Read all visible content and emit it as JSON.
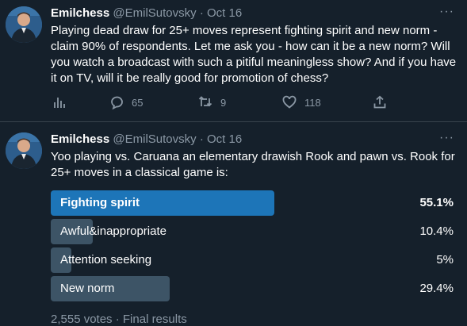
{
  "tweets": [
    {
      "name": "Emilchess",
      "handle": "@EmilSutovsky",
      "sep": "·",
      "date": "Oct 16",
      "more": "···",
      "text": "Playing dead draw for 25+ moves represent fighting spirit and new norm - claim 90% of respondents. Let me ask you - how can it be a new norm? Will you watch a broadcast with such a pitiful meaningless show? And if you have it on TV, will it be really good for promotion of chess?",
      "actions": {
        "analytics_icon": "bar-chart-icon",
        "reply_icon": "reply-icon",
        "reply_count": "65",
        "retweet_icon": "retweet-icon",
        "retweet_count": "9",
        "like_icon": "heart-icon",
        "like_count": "118",
        "share_icon": "share-icon"
      }
    },
    {
      "name": "Emilchess",
      "handle": "@EmilSutovsky",
      "sep": "·",
      "date": "Oct 16",
      "more": "···",
      "text": "Yoo playing vs. Caruana an elementary drawish Rook and pawn vs. Rook for 25+ moves in a classical game is:",
      "poll": {
        "options": [
          {
            "label": "Fighting spirit",
            "percent": "55.1%",
            "value": 55.1,
            "winner": true
          },
          {
            "label": "Awful&inappropriate",
            "percent": "10.4%",
            "value": 10.4,
            "winner": false
          },
          {
            "label": "Attention seeking",
            "percent": "5%",
            "value": 5,
            "winner": false
          },
          {
            "label": "New norm",
            "percent": "29.4%",
            "value": 29.4,
            "winner": false
          }
        ],
        "footer": "2,555 votes · Final results"
      }
    }
  ],
  "colors": {
    "background": "#15202b",
    "divider": "#38444d",
    "secondary_text": "#8b98a5",
    "poll_winner": "#1d75b8",
    "poll_bar": "#3d5466"
  }
}
